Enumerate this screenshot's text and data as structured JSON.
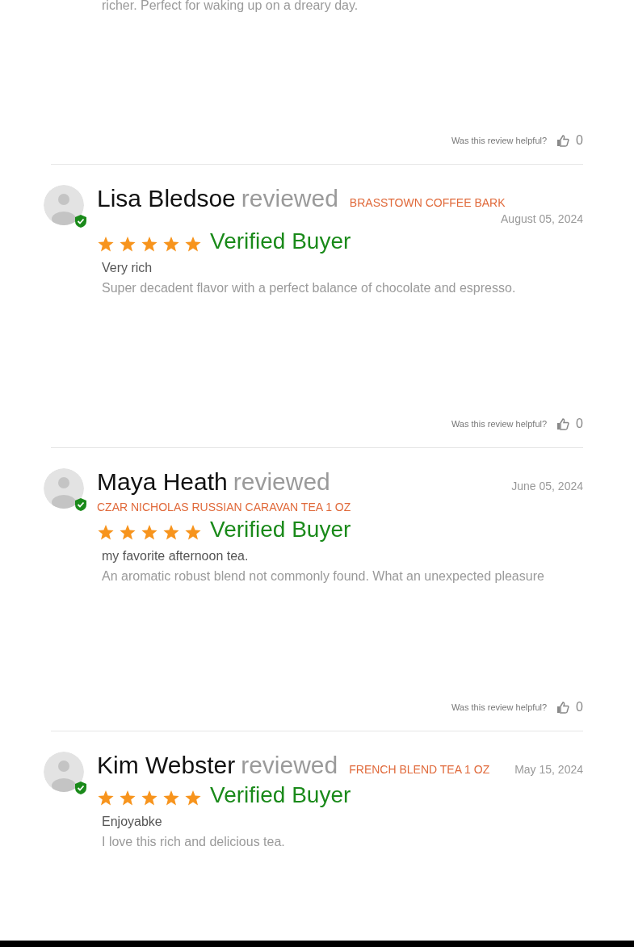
{
  "top_fragment": {
    "body": "richer. Perfect for waking up on a dreary day.",
    "helpful_label": "Was this review helpful?",
    "helpful_count": "0"
  },
  "reviews": [
    {
      "reviewer": "Lisa Bledsoe",
      "action": "reviewed",
      "product": "BRASSTOWN COFFEE BARK",
      "date": "August 05, 2024",
      "stars": 5,
      "badge": "Verified Buyer",
      "title": "Very rich",
      "body": "Super decadent flavor with a perfect balance of chocolate and espresso.",
      "helpful_label": "Was this review helpful?",
      "helpful_count": "0"
    },
    {
      "reviewer": "Maya Heath",
      "action": "reviewed",
      "product": "CZAR NICHOLAS RUSSIAN CARAVAN TEA 1 OZ",
      "date": "June 05, 2024",
      "stars": 5,
      "badge": "Verified Buyer",
      "title": "my favorite afternoon tea.",
      "body": "An aromatic robust blend not commonly found. What an unexpected pleasure",
      "helpful_label": "Was this review helpful?",
      "helpful_count": "0"
    },
    {
      "reviewer": "Kim Webster",
      "action": "reviewed",
      "product": "FRENCH BLEND TEA 1 OZ",
      "date": "May 15, 2024",
      "stars": 5,
      "badge": "Verified Buyer",
      "title": "Enjoyabke",
      "body": "I love this rich and delicious tea."
    }
  ]
}
